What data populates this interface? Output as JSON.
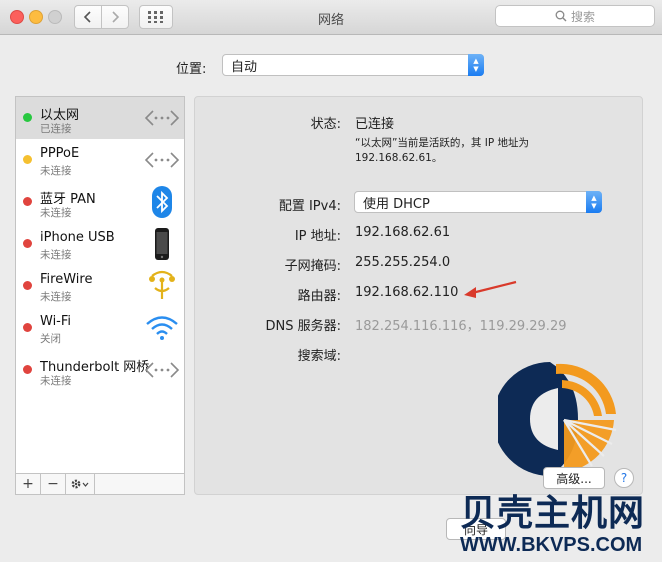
{
  "window": {
    "title": "网络"
  },
  "search": {
    "placeholder": "搜索"
  },
  "location": {
    "label": "位置:",
    "value": "自动"
  },
  "services": [
    {
      "name": "以太网",
      "status": "已连接",
      "status_color": "#28c840",
      "icon": "ethernet-icon",
      "selected": true
    },
    {
      "name": "PPPoE",
      "status": "未连接",
      "status_color": "#f5c030",
      "icon": "ethernet-icon"
    },
    {
      "name": "蓝牙 PAN",
      "status": "未连接",
      "status_color": "#e0443e",
      "icon": "bluetooth-icon"
    },
    {
      "name": "iPhone USB",
      "status": "未连接",
      "status_color": "#e0443e",
      "icon": "iphone-icon"
    },
    {
      "name": "FireWire",
      "status": "未连接",
      "status_color": "#e0443e",
      "icon": "firewire-icon"
    },
    {
      "name": "Wi-Fi",
      "status": "关闭",
      "status_color": "#e0443e",
      "icon": "wifi-icon"
    },
    {
      "name": "Thunderbolt 网桥",
      "status": "未连接",
      "status_color": "#e0443e",
      "icon": "ethernet-icon"
    }
  ],
  "sidebar_buttons": {
    "add": "+",
    "remove": "−"
  },
  "details": {
    "status_label": "状态:",
    "status_value": "已连接",
    "status_desc_line1": "“以太网”当前是活跃的，其 IP 地址为",
    "status_desc_line2": "192.168.62.61。",
    "ipv4_label": "配置 IPv4:",
    "ipv4_value": "使用 DHCP",
    "ip_label": "IP 地址:",
    "ip_value": "192.168.62.61",
    "mask_label": "子网掩码:",
    "mask_value": "255.255.254.0",
    "router_label": "路由器:",
    "router_value": "192.168.62.110",
    "dns_label": "DNS 服务器:",
    "dns_value": "182.254.116.116，119.29.29.29",
    "search_domain_label": "搜索域:"
  },
  "advanced_button": "高级...",
  "help_button": "?",
  "bottom_button": "向导",
  "watermark": {
    "brand": "贝壳主机网",
    "url": "WWW.BKVPS.COM"
  },
  "colors": {
    "accent": "#1a7cf1",
    "arrow": "#d93a2b",
    "logo_navy": "#0d2a55",
    "logo_orange": "#f39a1e"
  }
}
